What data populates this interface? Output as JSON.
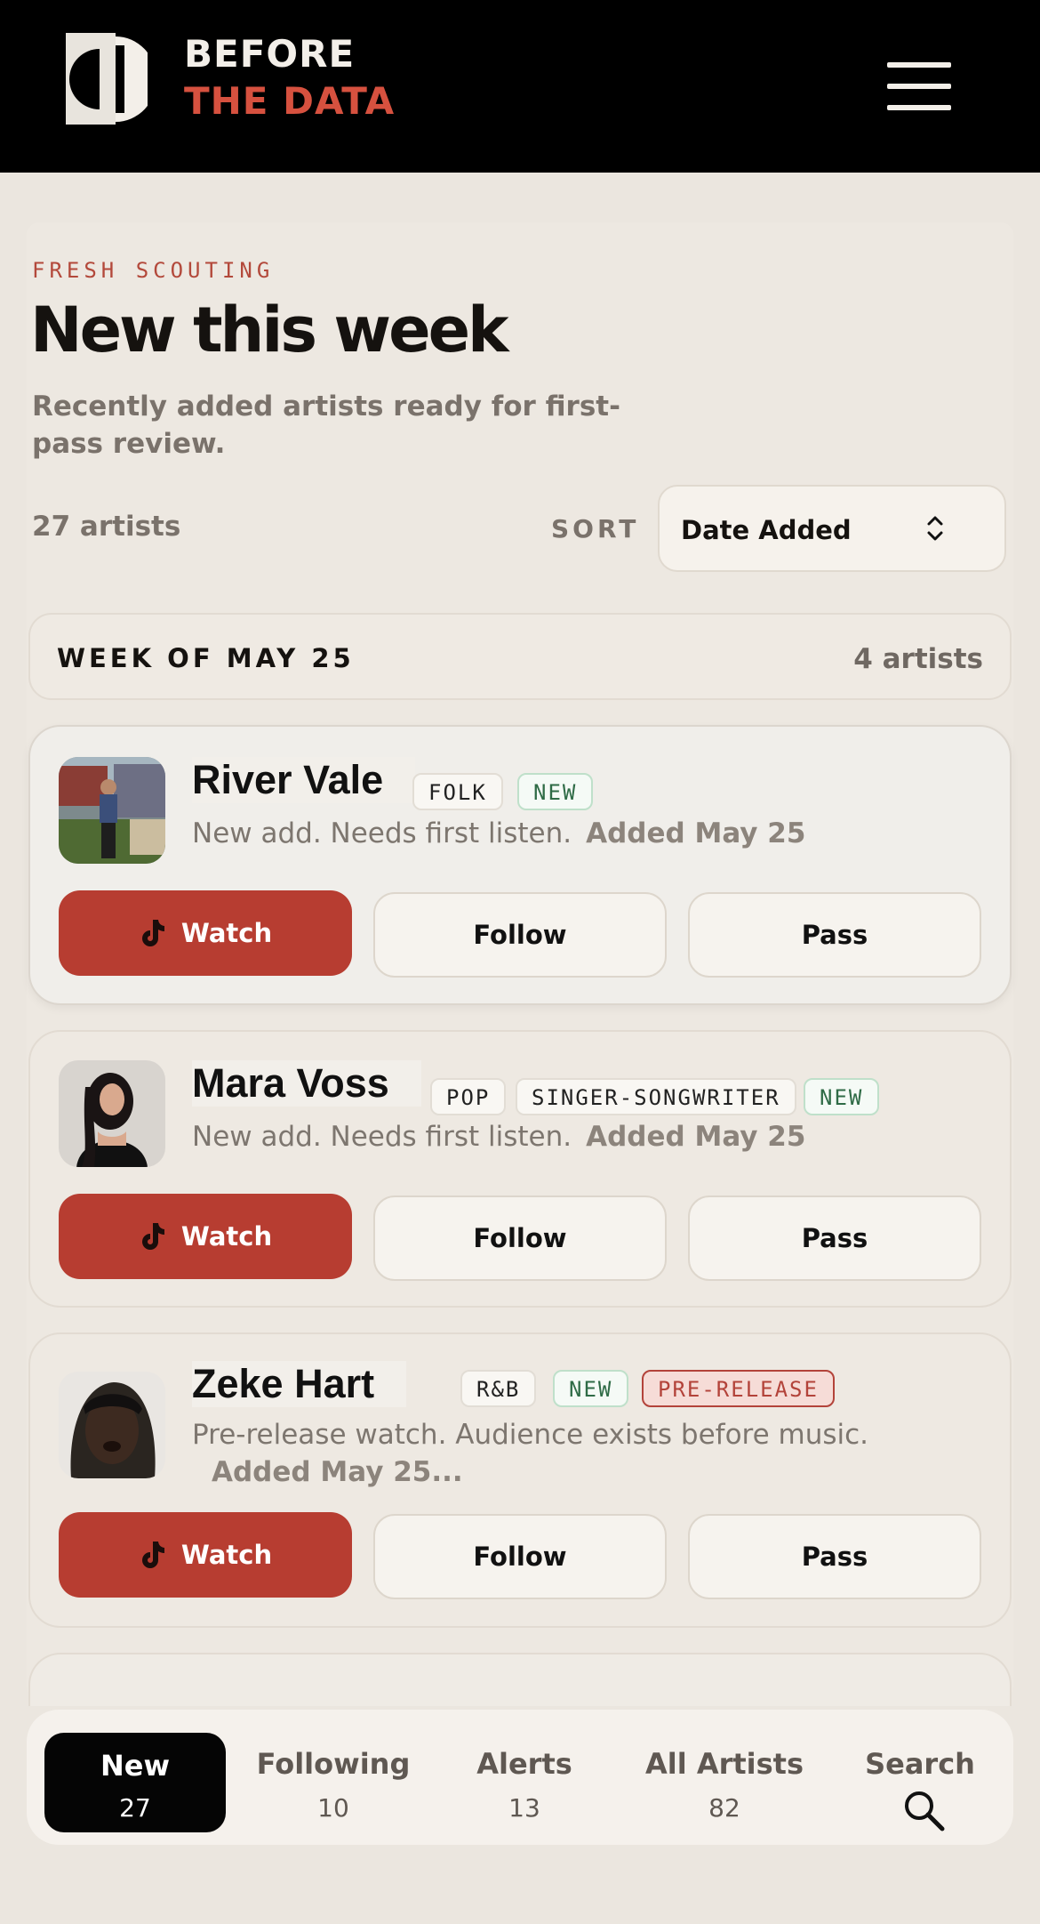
{
  "brand": {
    "line1": "BEFORE",
    "line2": "THE DATA",
    "accent": "#d6513f"
  },
  "header": {
    "menu_icon": "hamburger-menu-icon"
  },
  "section": {
    "eyebrow": "FRESH SCOUTING",
    "title": "New this week",
    "subtitle": "Recently added artists ready for first-pass review.",
    "count": "27 artists",
    "sort_label": "SORT",
    "sort_value": "Date Added"
  },
  "week": {
    "label": "WEEK OF MAY 25",
    "count": "4 artists"
  },
  "artists": [
    {
      "name": "River Vale",
      "tags": [
        "FOLK",
        "NEW"
      ],
      "description": "New add. Needs first listen.",
      "added": "Added May 25",
      "watch": "Watch",
      "follow": "Follow",
      "pass": "Pass"
    },
    {
      "name": "Mara Voss",
      "tags": [
        "POP",
        "SINGER-SONGWRITER",
        "NEW"
      ],
      "description": "New add. Needs first listen.",
      "added": "Added May 25",
      "watch": "Watch",
      "follow": "Follow",
      "pass": "Pass"
    },
    {
      "name": "Zeke Hart",
      "tags": [
        "R&B",
        "NEW",
        "PRE-RELEASE"
      ],
      "description": "Pre-release watch. Audience exists before music.",
      "added": "Added May 25...",
      "watch": "Watch",
      "follow": "Follow",
      "pass": "Pass"
    }
  ],
  "nav": [
    {
      "label": "New",
      "count": "27",
      "active": true
    },
    {
      "label": "Following",
      "count": "10"
    },
    {
      "label": "Alerts",
      "count": "13"
    },
    {
      "label": "All Artists",
      "count": "82"
    },
    {
      "label": "Search",
      "icon": "search-icon"
    }
  ],
  "colors": {
    "watch": "#b73d31",
    "new_tag": "#2f6b46",
    "pre_release_tag": "#b3433a",
    "background": "#ebe6df"
  }
}
